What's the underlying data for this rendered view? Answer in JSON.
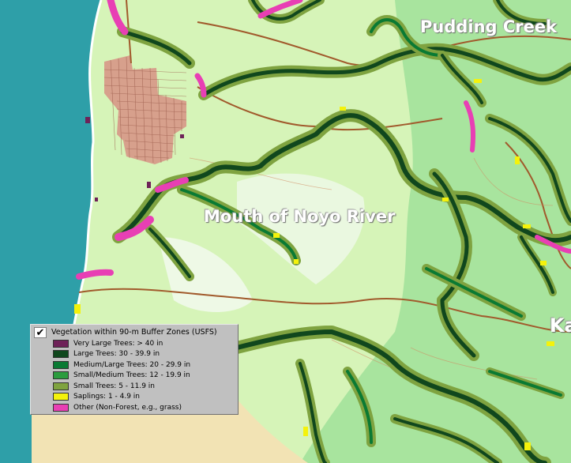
{
  "map": {
    "labels": {
      "pudding_creek": "Pudding Creek",
      "noyo_river": "Mouth of Noyo River",
      "kass": "Ka"
    },
    "colors": {
      "ocean": "#2e9fa8",
      "beach": "#f2e3b4",
      "town": "#d7a08c",
      "land": "#d6f4b8",
      "forest": "#a8e49e",
      "road": "#a15a2c"
    }
  },
  "legend": {
    "title": "Vegetation within 90-m Buffer Zones (USFS)",
    "checked": true,
    "check_icon": "checkmark-icon",
    "items": [
      {
        "label": "Very Large Trees: > 40  in",
        "color": "#6e2258"
      },
      {
        "label": "Large Trees: 30 - 39.9 in",
        "color": "#10471d"
      },
      {
        "label": "Medium/Large Trees: 20 - 29.9 in",
        "color": "#0a7a33"
      },
      {
        "label": "Small/Medium Trees: 12 - 19.9 in",
        "color": "#2b9c3e"
      },
      {
        "label": "Small Trees: 5 - 11.9 in",
        "color": "#7fa340"
      },
      {
        "label": "Saplings: 1 - 4.9 in",
        "color": "#f4f20c"
      },
      {
        "label": "Other (Non-Forest, e.g., grass)",
        "color": "#e83fb4"
      }
    ]
  }
}
